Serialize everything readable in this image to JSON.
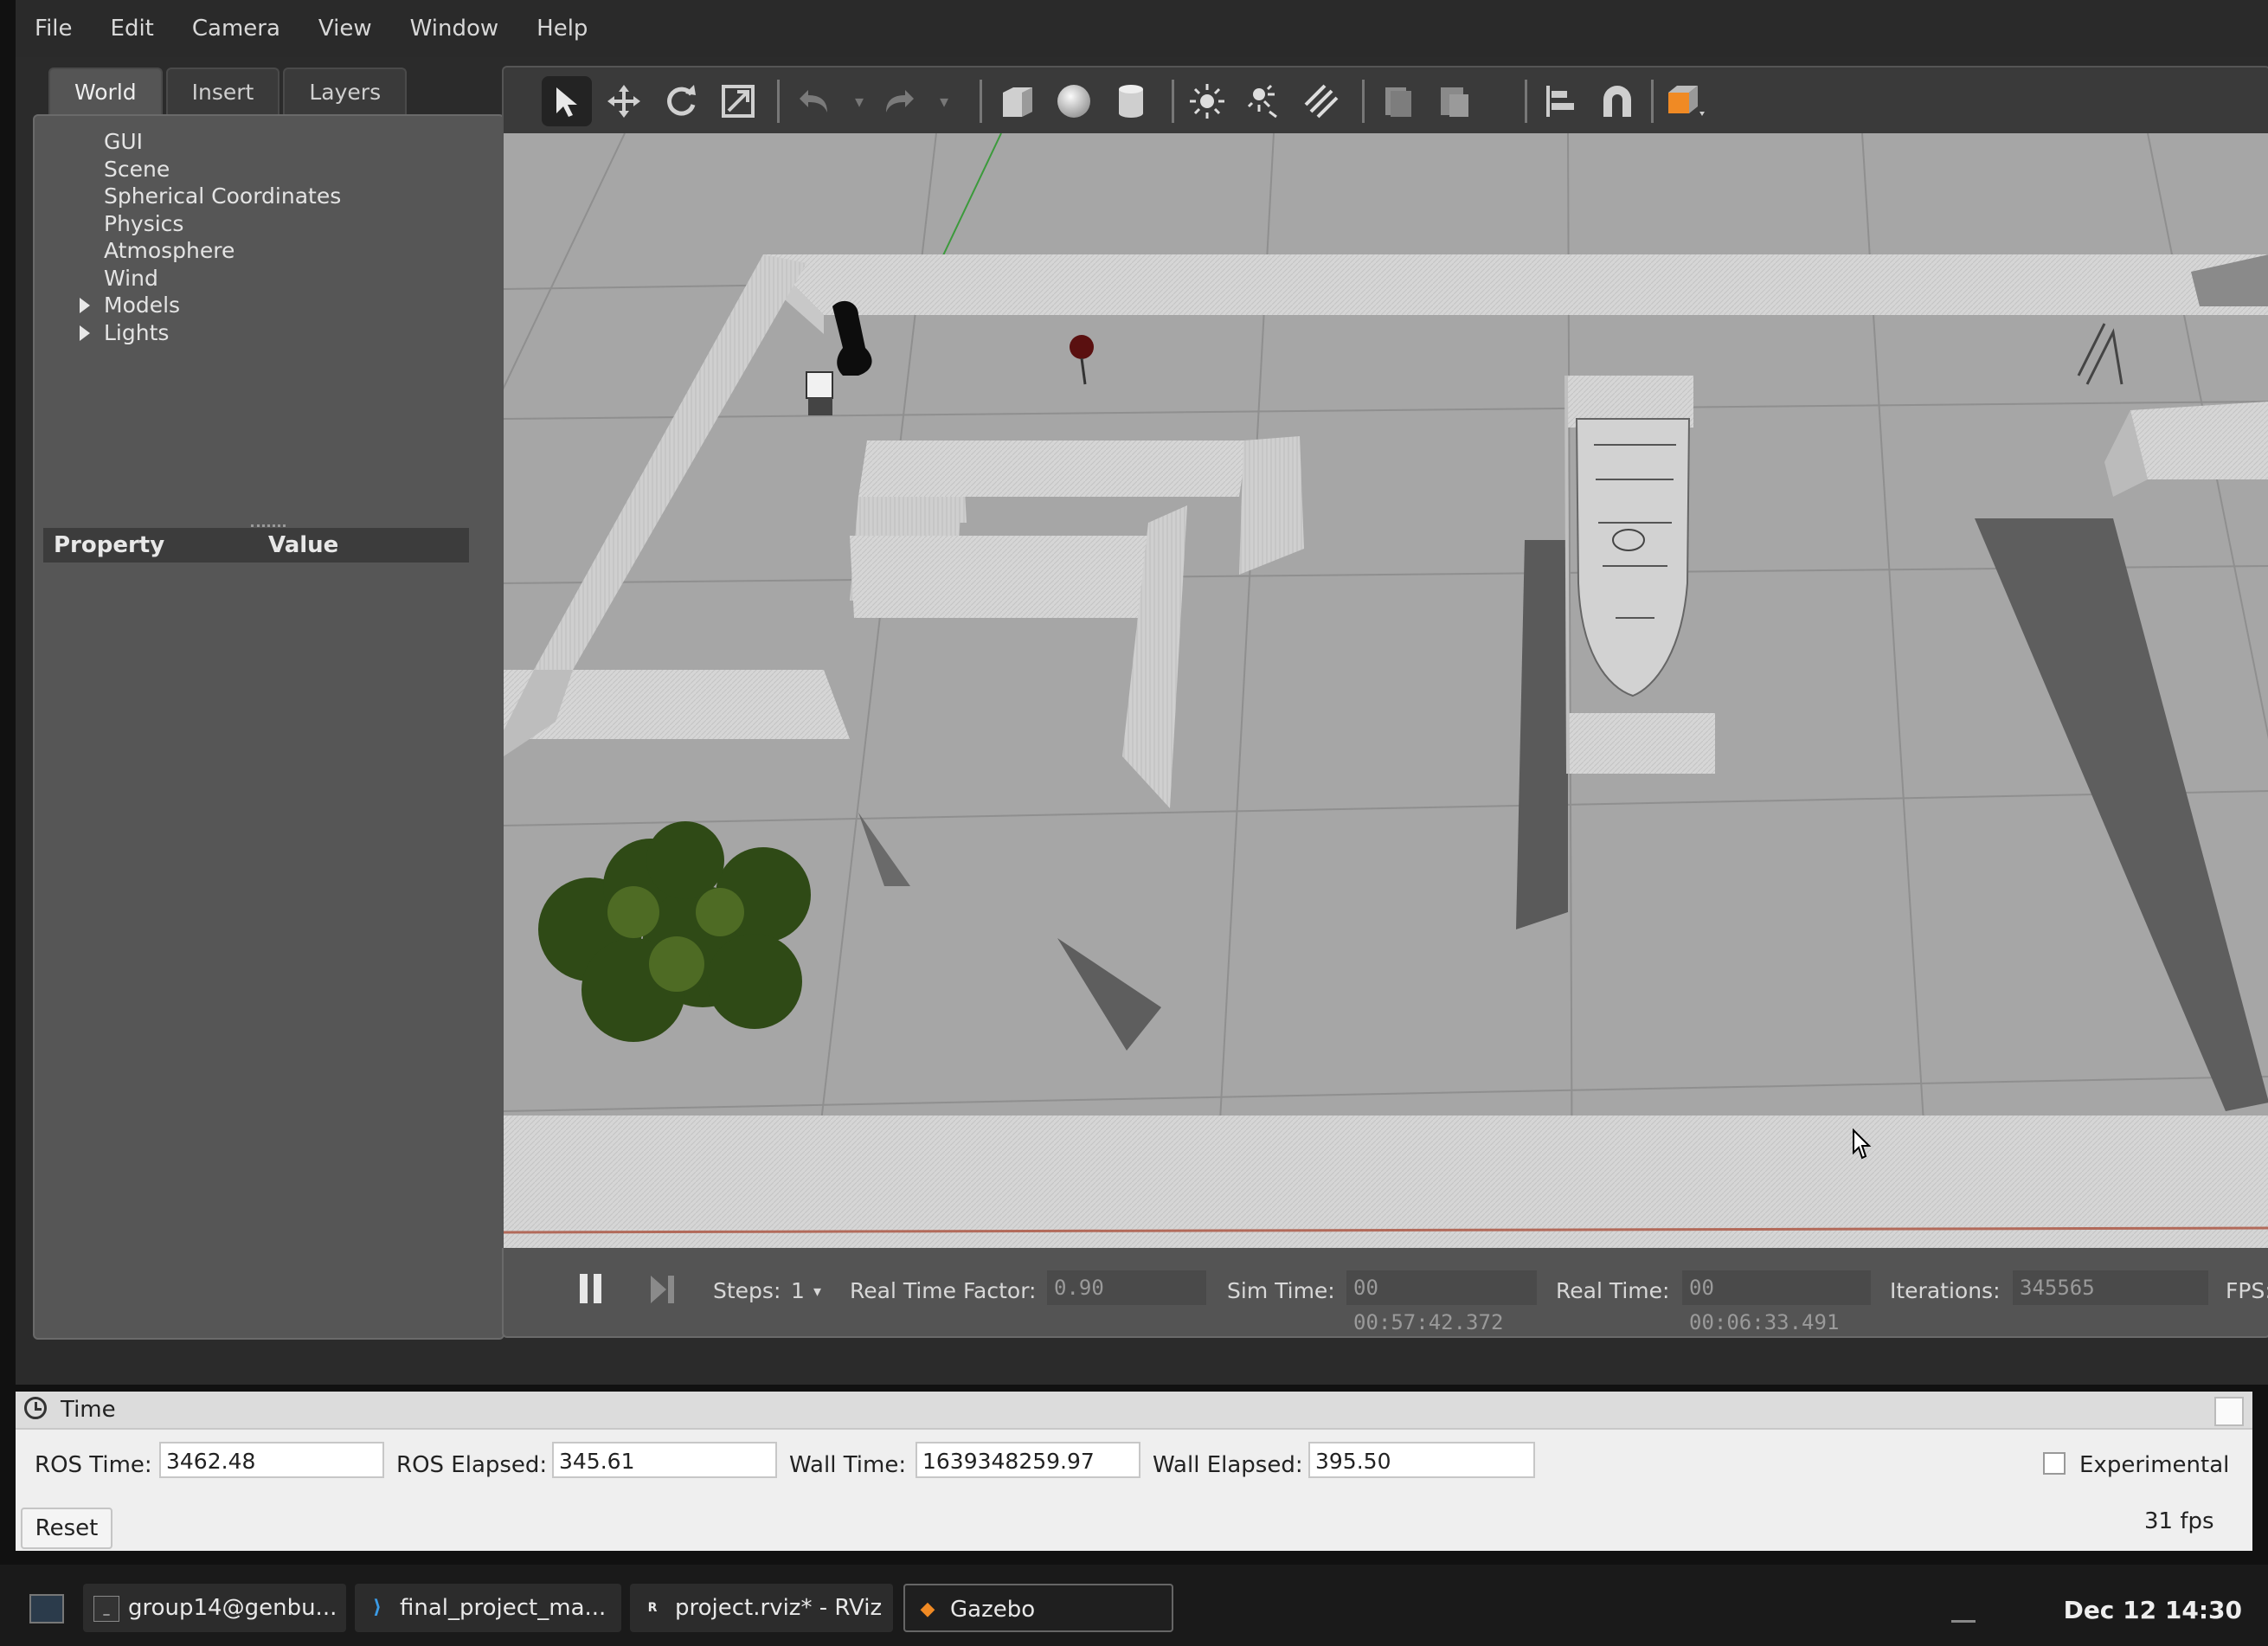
{
  "menu": [
    "File",
    "Edit",
    "Camera",
    "View",
    "Window",
    "Help"
  ],
  "tabs": [
    "World",
    "Insert",
    "Layers"
  ],
  "world_tree": [
    {
      "label": "GUI",
      "expandable": false
    },
    {
      "label": "Scene",
      "expandable": false
    },
    {
      "label": "Spherical Coordinates",
      "expandable": false
    },
    {
      "label": "Physics",
      "expandable": false
    },
    {
      "label": "Atmosphere",
      "expandable": false
    },
    {
      "label": "Wind",
      "expandable": false
    },
    {
      "label": "Models",
      "expandable": true
    },
    {
      "label": "Lights",
      "expandable": true
    }
  ],
  "property_header": {
    "property": "Property",
    "value": "Value"
  },
  "toolbar_icons": [
    "select-arrow-icon",
    "translate-icon",
    "rotate-icon",
    "scale-icon",
    "undo-icon",
    "undo-dropdown-icon",
    "redo-icon",
    "redo-dropdown-icon",
    "box-shape-icon",
    "sphere-shape-icon",
    "cylinder-shape-icon",
    "point-light-icon",
    "spot-light-icon",
    "directional-light-icon",
    "copy-icon",
    "paste-icon",
    "align-icon",
    "snap-magnet-icon",
    "view-angle-icon"
  ],
  "simbar": {
    "steps_label": "Steps:",
    "steps_value": "1",
    "rtf_label": "Real Time Factor:",
    "rtf_value": "0.90",
    "sim_time_label": "Sim Time:",
    "sim_time_value": "00 00:57:42.372",
    "real_time_label": "Real Time:",
    "real_time_value": "00 00:06:33.491",
    "iterations_label": "Iterations:",
    "iterations_value": "345565",
    "fps_label": "FPS:"
  },
  "time_panel": {
    "title": "Time",
    "ros_time_label": "ROS Time:",
    "ros_time_value": "3462.48",
    "ros_elapsed_label": "ROS Elapsed:",
    "ros_elapsed_value": "345.61",
    "wall_time_label": "Wall Time:",
    "wall_time_value": "1639348259.97",
    "wall_elapsed_label": "Wall Elapsed:",
    "wall_elapsed_value": "395.50",
    "experimental_label": "Experimental",
    "experimental_checked": false,
    "fps": "31 fps",
    "reset_label": "Reset"
  },
  "taskbar": {
    "tasks": [
      {
        "label": "group14@genbu...",
        "icon": "terminal-icon"
      },
      {
        "label": "final_project_ma...",
        "icon": "vscode-icon"
      },
      {
        "label": "project.rviz* - RViz",
        "icon": "rviz-icon"
      },
      {
        "label": "Gazebo",
        "icon": "gazebo-icon",
        "active": true
      }
    ],
    "clock": "Dec 12 14:30"
  },
  "colors": {
    "ground": "#a5a5a5",
    "wall": "#d4d4d4",
    "accent_orange": "#f08a24"
  }
}
